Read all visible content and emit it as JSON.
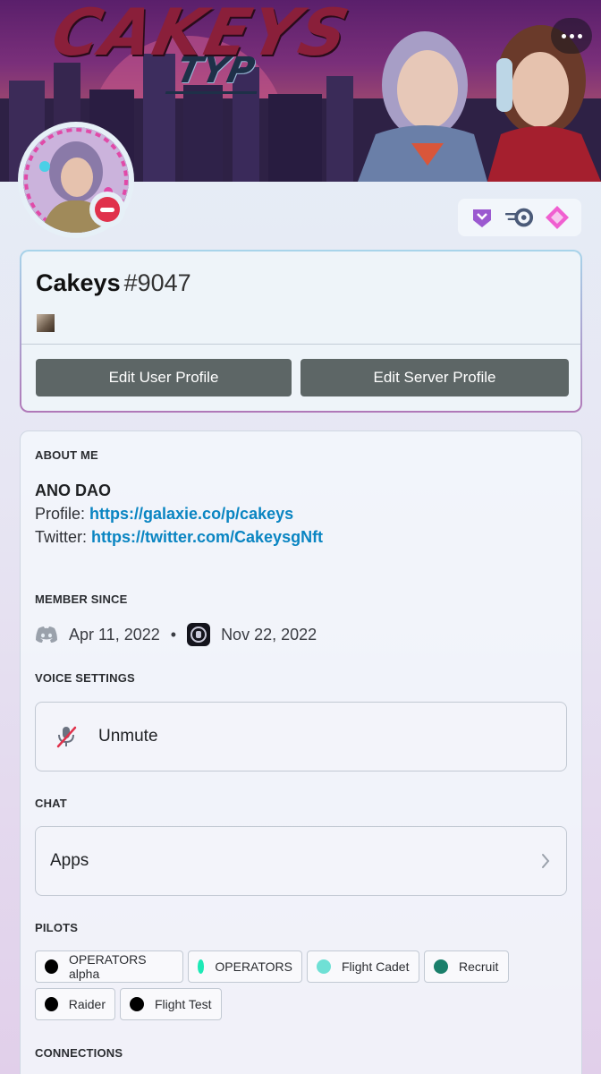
{
  "banner": {
    "title": "CAKEYS",
    "subtitle": "TYP"
  },
  "badges": [
    "hypesquad-icon",
    "nitro-speed-icon",
    "boost-gem-icon"
  ],
  "profile": {
    "username": "Cakeys",
    "discriminator": "#9047",
    "edit_user_label": "Edit User Profile",
    "edit_server_label": "Edit Server Profile"
  },
  "about": {
    "title": "ABOUT ME",
    "line1": "ANO DAO",
    "profile_prefix": "Profile: ",
    "profile_link": "https://galaxie.co/p/cakeys",
    "twitter_prefix": "Twitter: ",
    "twitter_link": "https://twitter.com/CakeysgNft"
  },
  "member_since": {
    "title": "MEMBER SINCE",
    "discord_date": "Apr 11, 2022",
    "separator": "•",
    "server_date": "Nov 22, 2022"
  },
  "voice": {
    "title": "VOICE SETTINGS",
    "unmute_label": "Unmute"
  },
  "chat": {
    "title": "CHAT",
    "apps_label": "Apps"
  },
  "pilots": {
    "title": "PILOTS",
    "roles": [
      {
        "name": "OPERATORS alpha",
        "color": "#000000"
      },
      {
        "name": "OPERATORS",
        "color": "#1de9b6"
      },
      {
        "name": "Flight Cadet",
        "color": "#6fe0d5"
      },
      {
        "name": "Recruit",
        "color": "#1a7f6b"
      },
      {
        "name": "Raider",
        "color": "#000000"
      },
      {
        "name": "Flight Test",
        "color": "#000000"
      }
    ]
  },
  "connections": {
    "title": "CONNECTIONS"
  },
  "colors": {
    "link": "#0a85c2",
    "button": "#5d6666",
    "dnd": "#e0314b"
  }
}
